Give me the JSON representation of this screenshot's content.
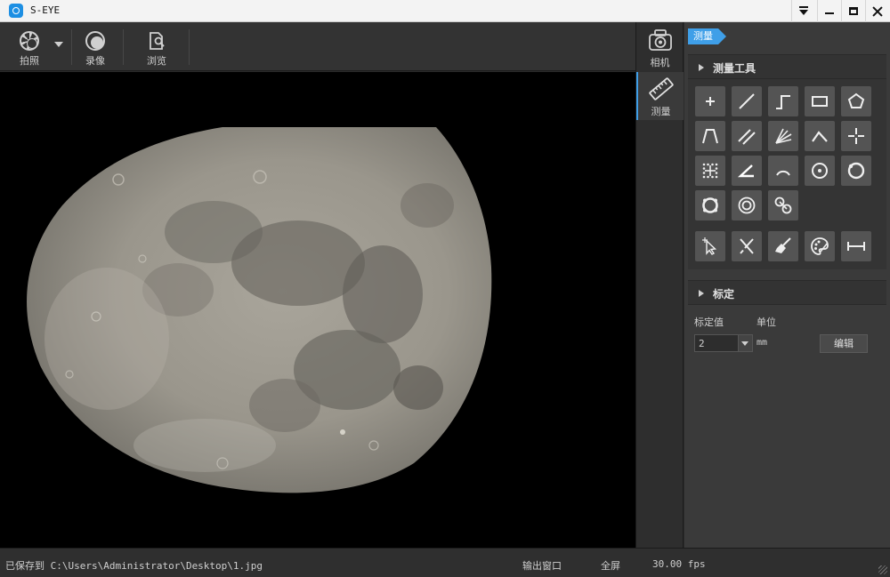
{
  "window": {
    "title": "S-EYE"
  },
  "toolbar": {
    "capture_label": "拍照",
    "record_label": "录像",
    "browse_label": "浏览"
  },
  "side_tabs": [
    {
      "label": "相机",
      "icon": "camera-icon",
      "active": false
    },
    {
      "label": "测量",
      "icon": "ruler-icon",
      "active": true
    }
  ],
  "panel": {
    "tag": "测量",
    "tools_section": {
      "title": "测量工具"
    },
    "tools": [
      {
        "name": "point-tool",
        "icon": "plus-icon"
      },
      {
        "name": "line-tool",
        "icon": "line-icon"
      },
      {
        "name": "polyline-tool",
        "icon": "step-line-icon"
      },
      {
        "name": "rectangle-tool",
        "icon": "rectangle-icon"
      },
      {
        "name": "polygon-tool",
        "icon": "pentagon-icon"
      },
      {
        "name": "trapezoid-tool",
        "icon": "trapezoid-icon"
      },
      {
        "name": "parallel-lines-tool",
        "icon": "parallel-lines-icon"
      },
      {
        "name": "multi-parallel-tool",
        "icon": "multi-lines-icon"
      },
      {
        "name": "angle-vertex-tool",
        "icon": "caret-angle-icon"
      },
      {
        "name": "cross-tool",
        "icon": "crosshair-icon"
      },
      {
        "name": "grid-points-tool",
        "icon": "grid-dots-icon"
      },
      {
        "name": "angle-tool",
        "icon": "angle-icon"
      },
      {
        "name": "arc-tool",
        "icon": "arc-icon"
      },
      {
        "name": "circle-center-tool",
        "icon": "circle-dot-icon"
      },
      {
        "name": "three-point-circle-tool",
        "icon": "circle-three-point-icon"
      },
      {
        "name": "four-point-circle-tool",
        "icon": "circle-four-point-icon"
      },
      {
        "name": "concentric-circle-tool",
        "icon": "concentric-circle-icon"
      },
      {
        "name": "circle-distance-tool",
        "icon": "two-circles-icon"
      }
    ],
    "actions": [
      {
        "name": "select-tool",
        "icon": "cursor-move-icon"
      },
      {
        "name": "delete-tool",
        "icon": "scissors-icon"
      },
      {
        "name": "clear-tool",
        "icon": "broom-icon"
      },
      {
        "name": "color-tool",
        "icon": "palette-icon"
      },
      {
        "name": "scale-bar-tool",
        "icon": "scale-bar-icon"
      }
    ],
    "calibration_section": {
      "title": "标定"
    },
    "calibration": {
      "value_label": "标定值",
      "unit_label": "单位",
      "value": "2",
      "unit": "mm",
      "edit_label": "编辑"
    }
  },
  "status": {
    "saved_path": "已保存到 C:\\Users\\Administrator\\Desktop\\1.jpg",
    "output_window": "输出窗口",
    "fullscreen": "全屏",
    "fps": "30.00 fps"
  },
  "colors": {
    "accent": "#3f9fe8",
    "background": "#2b2b2b",
    "panel": "#3a3a3a",
    "tool_button": "#545454"
  }
}
